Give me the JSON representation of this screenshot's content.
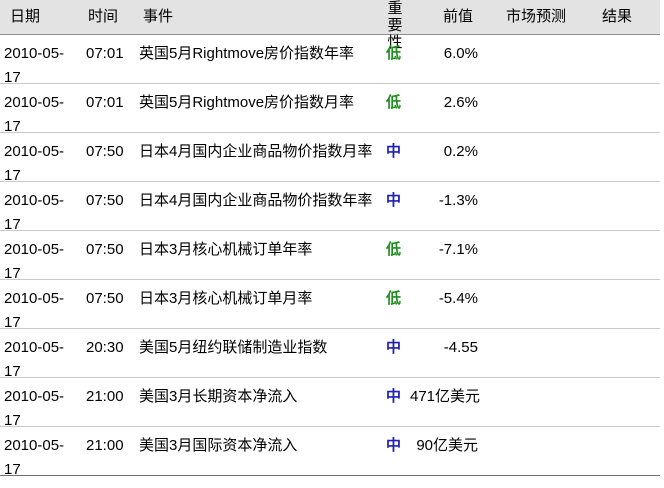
{
  "headers": {
    "date": "日期",
    "time": "时间",
    "event": "事件",
    "importance": "重要性",
    "previous": "前值",
    "forecast": "市场预测",
    "result": "结果"
  },
  "colors": {
    "importance_low": "#1e8f1e",
    "importance_mid": "#1f21b6",
    "header_bg": "#e3e3e3"
  },
  "rows": [
    {
      "date": "2010-05-17",
      "time": "07:01",
      "event": "英国5月Rightmove房价指数年率",
      "importance": "低",
      "level": "low",
      "previous": "6.0%",
      "forecast": "",
      "result": ""
    },
    {
      "date": "2010-05-17",
      "time": "07:01",
      "event": "英国5月Rightmove房价指数月率",
      "importance": "低",
      "level": "low",
      "previous": "2.6%",
      "forecast": "",
      "result": ""
    },
    {
      "date": "2010-05-17",
      "time": "07:50",
      "event": "日本4月国内企业商品物价指数月率",
      "importance": "中",
      "level": "mid",
      "previous": "0.2%",
      "forecast": "",
      "result": ""
    },
    {
      "date": "2010-05-17",
      "time": "07:50",
      "event": "日本4月国内企业商品物价指数年率",
      "importance": "中",
      "level": "mid",
      "previous": "-1.3%",
      "forecast": "",
      "result": ""
    },
    {
      "date": "2010-05-17",
      "time": "07:50",
      "event": "日本3月核心机械订单年率",
      "importance": "低",
      "level": "low",
      "previous": "-7.1%",
      "forecast": "",
      "result": ""
    },
    {
      "date": "2010-05-17",
      "time": "07:50",
      "event": "日本3月核心机械订单月率",
      "importance": "低",
      "level": "low",
      "previous": "-5.4%",
      "forecast": "",
      "result": ""
    },
    {
      "date": "2010-05-17",
      "time": "20:30",
      "event": "美国5月纽约联储制造业指数",
      "importance": "中",
      "level": "mid",
      "previous": "-4.55",
      "forecast": "",
      "result": ""
    },
    {
      "date": "2010-05-17",
      "time": "21:00",
      "event": "美国3月长期资本净流入",
      "importance": "中",
      "level": "mid",
      "previous": "471亿美元",
      "forecast": "",
      "result": ""
    },
    {
      "date": "2010-05-17",
      "time": "21:00",
      "event": "美国3月国际资本净流入",
      "importance": "中",
      "level": "mid",
      "previous": "90亿美元",
      "forecast": "",
      "result": ""
    }
  ]
}
